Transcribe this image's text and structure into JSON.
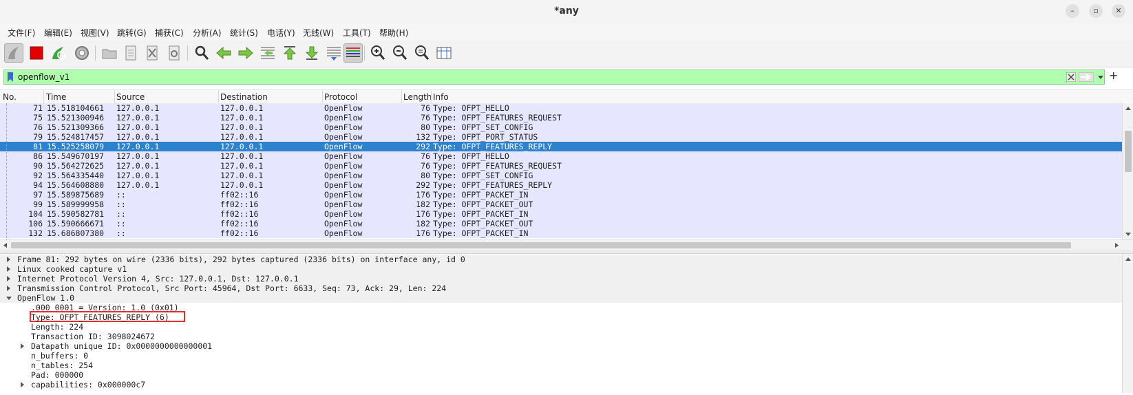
{
  "window": {
    "title": "*any"
  },
  "menu": [
    "文件(F)",
    "编辑(E)",
    "视图(V)",
    "跳转(G)",
    "捕获(C)",
    "分析(A)",
    "统计(S)",
    "电话(Y)",
    "无线(W)",
    "工具(T)",
    "帮助(H)"
  ],
  "filter": {
    "value": "openflow_v1"
  },
  "columns": [
    "No.",
    "Time",
    "Source",
    "Destination",
    "Protocol",
    "Length",
    "Info"
  ],
  "packets": [
    {
      "no": "71",
      "time": "15.518104661",
      "src": "127.0.0.1",
      "dst": "127.0.0.1",
      "proto": "OpenFlow",
      "len": "76",
      "info": "Type: OFPT_HELLO"
    },
    {
      "no": "75",
      "time": "15.521300946",
      "src": "127.0.0.1",
      "dst": "127.0.0.1",
      "proto": "OpenFlow",
      "len": "76",
      "info": "Type: OFPT_FEATURES_REQUEST"
    },
    {
      "no": "76",
      "time": "15.521309366",
      "src": "127.0.0.1",
      "dst": "127.0.0.1",
      "proto": "OpenFlow",
      "len": "80",
      "info": "Type: OFPT_SET_CONFIG"
    },
    {
      "no": "79",
      "time": "15.524817457",
      "src": "127.0.0.1",
      "dst": "127.0.0.1",
      "proto": "OpenFlow",
      "len": "132",
      "info": "Type: OFPT_PORT_STATUS"
    },
    {
      "no": "81",
      "time": "15.525258079",
      "src": "127.0.0.1",
      "dst": "127.0.0.1",
      "proto": "OpenFlow",
      "len": "292",
      "info": "Type: OFPT_FEATURES_REPLY"
    },
    {
      "no": "86",
      "time": "15.549670197",
      "src": "127.0.0.1",
      "dst": "127.0.0.1",
      "proto": "OpenFlow",
      "len": "76",
      "info": "Type: OFPT_HELLO"
    },
    {
      "no": "90",
      "time": "15.564272625",
      "src": "127.0.0.1",
      "dst": "127.0.0.1",
      "proto": "OpenFlow",
      "len": "76",
      "info": "Type: OFPT_FEATURES_REQUEST"
    },
    {
      "no": "92",
      "time": "15.564335440",
      "src": "127.0.0.1",
      "dst": "127.0.0.1",
      "proto": "OpenFlow",
      "len": "80",
      "info": "Type: OFPT_SET_CONFIG"
    },
    {
      "no": "94",
      "time": "15.564608880",
      "src": "127.0.0.1",
      "dst": "127.0.0.1",
      "proto": "OpenFlow",
      "len": "292",
      "info": "Type: OFPT_FEATURES_REPLY"
    },
    {
      "no": "97",
      "time": "15.589875689",
      "src": "::",
      "dst": "ff02::16",
      "proto": "OpenFlow",
      "len": "176",
      "info": "Type: OFPT_PACKET_IN"
    },
    {
      "no": "99",
      "time": "15.589999958",
      "src": "::",
      "dst": "ff02::16",
      "proto": "OpenFlow",
      "len": "182",
      "info": "Type: OFPT_PACKET_OUT"
    },
    {
      "no": "104",
      "time": "15.590582781",
      "src": "::",
      "dst": "ff02::16",
      "proto": "OpenFlow",
      "len": "176",
      "info": "Type: OFPT_PACKET_IN"
    },
    {
      "no": "106",
      "time": "15.590666671",
      "src": "::",
      "dst": "ff02::16",
      "proto": "OpenFlow",
      "len": "182",
      "info": "Type: OFPT_PACKET_OUT"
    },
    {
      "no": "132",
      "time": "15.686807380",
      "src": "::",
      "dst": "ff02::16",
      "proto": "OpenFlow",
      "len": "176",
      "info": "Type: OFPT_PACKET_IN"
    }
  ],
  "details": [
    "Frame 81: 292 bytes on wire (2336 bits), 292 bytes captured (2336 bits) on interface any, id 0",
    "Linux cooked capture v1",
    "Internet Protocol Version 4, Src: 127.0.0.1, Dst: 127.0.0.1",
    "Transmission Control Protocol, Src Port: 45964, Dst Port: 6633, Seq: 73, Ack: 29, Len: 224",
    "OpenFlow 1.0",
    ".000 0001 = Version: 1.0 (0x01)",
    "Type: OFPT_FEATURES_REPLY (6)",
    "Length: 224",
    "Transaction ID: 3098024672",
    "Datapath unique ID: 0x0000000000000001",
    "n_buffers: 0",
    "n_tables: 254",
    "Pad: 000000",
    "capabilities: 0x000000c7"
  ],
  "colors": {
    "filter_bg": "#afffaf",
    "row_bg": "#e7e6ff",
    "selected_bg": "#2c82cc",
    "highlight": "#e03030"
  }
}
